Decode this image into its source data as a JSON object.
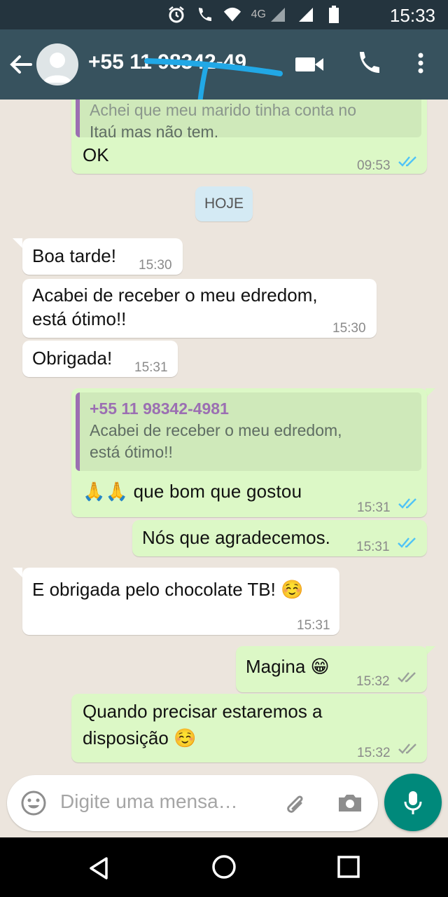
{
  "status_bar": {
    "time": "15:33",
    "network_label": "4G"
  },
  "header": {
    "contact_name": "+55 11 98342-49"
  },
  "chat": {
    "top_quote": "Achei que meu marido tinha conta no Itaú mas não tem.",
    "top_quote_line1": "Achei que meu marido tinha conta no",
    "top_quote_line2": "Itaú mas não tem.",
    "top_msg": {
      "text": "OK",
      "time": "09:53"
    },
    "day_label": "HOJE",
    "messages": [
      {
        "text": "Boa tarde!",
        "time": "15:30"
      },
      {
        "text_line1": "Acabei de receber o meu edredom,",
        "text_line2": "está ótimo!!",
        "time": "15:30"
      },
      {
        "text": "Obrigada!",
        "time": "15:31"
      },
      {
        "quote_name": "+55 11 98342-4981",
        "quote_line1": "Acabei de receber o meu edredom,",
        "quote_line2": "está ótimo!!",
        "text": "🙏🙏 que bom que gostou",
        "time": "15:31"
      },
      {
        "text": "Nós que agradecemos.",
        "time": "15:31"
      },
      {
        "text": "E obrigada pelo chocolate TB! ☺️",
        "time": "15:31"
      },
      {
        "text": "Magina 😁",
        "time": "15:32"
      },
      {
        "text_line1": "Quando precisar estaremos a",
        "text_line2": "disposição ☺️",
        "time": "15:32"
      }
    ]
  },
  "input": {
    "placeholder": "Digite uma mensa…"
  },
  "colors": {
    "status_bar": "#24343e",
    "app_bar": "#37525e",
    "outgoing_bubble": "#dcf8c6",
    "incoming_bubble": "#ffffff",
    "read_ticks": "#4fc3f7",
    "mic_button": "#00897b",
    "quote_accent": "#9b6fb2"
  },
  "icons": [
    "alarm-icon",
    "wifi-icon",
    "signal-icon",
    "battery-icon",
    "back-arrow-icon",
    "avatar-icon",
    "video-call-icon",
    "phone-icon",
    "more-icon",
    "emoji-icon",
    "attach-icon",
    "camera-icon",
    "mic-icon",
    "nav-back-icon",
    "nav-home-icon",
    "nav-recent-icon"
  ]
}
